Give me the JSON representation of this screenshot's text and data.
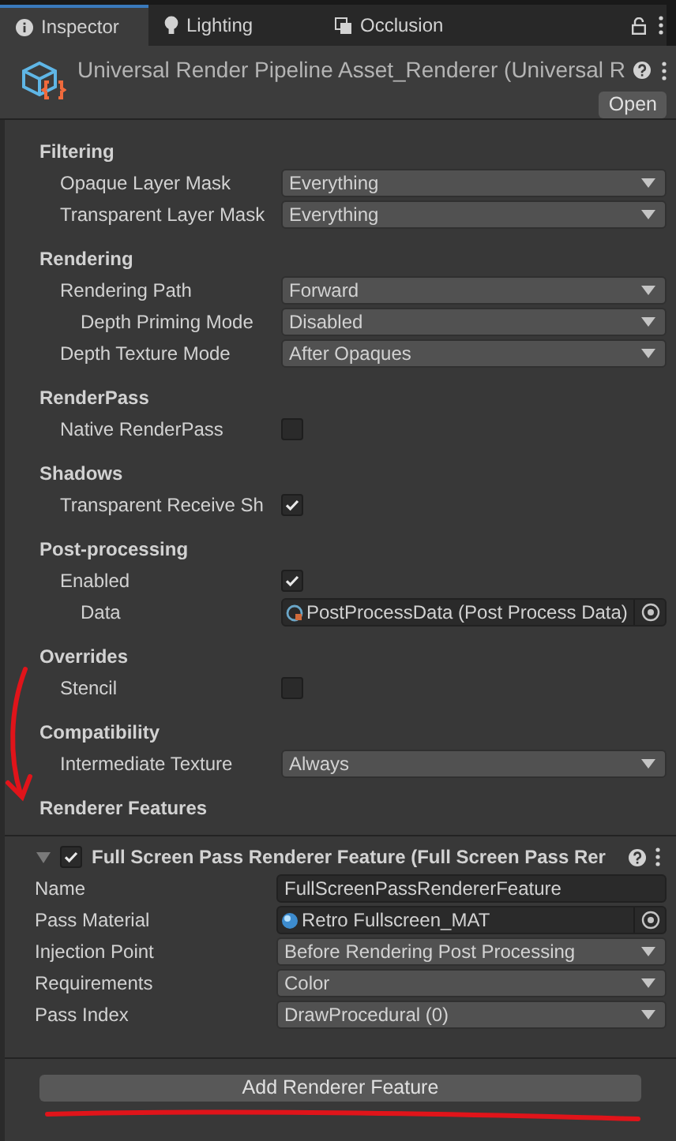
{
  "tabs": [
    {
      "label": "Inspector",
      "selected": true
    },
    {
      "label": "Lighting",
      "selected": false
    },
    {
      "label": "Occlusion",
      "selected": false
    }
  ],
  "header": {
    "title": "Universal Render Pipeline Asset_Renderer (Universal R",
    "open_button": "Open"
  },
  "sections": [
    {
      "title": "Filtering",
      "fields": [
        {
          "label": "Opaque Layer Mask",
          "kind": "dropdown",
          "value": "Everything"
        },
        {
          "label": "Transparent Layer Mask",
          "kind": "dropdown",
          "value": "Everything"
        }
      ]
    },
    {
      "title": "Rendering",
      "fields": [
        {
          "label": "Rendering Path",
          "kind": "dropdown",
          "value": "Forward",
          "children": [
            {
              "label": "Depth Priming Mode",
              "kind": "dropdown",
              "value": "Disabled"
            }
          ]
        },
        {
          "label": "Depth Texture Mode",
          "kind": "dropdown",
          "value": "After Opaques"
        }
      ]
    },
    {
      "title": "RenderPass",
      "fields": [
        {
          "label": "Native RenderPass",
          "kind": "checkbox",
          "checked": false
        }
      ]
    },
    {
      "title": "Shadows",
      "fields": [
        {
          "label": "Transparent Receive Sh",
          "kind": "checkbox",
          "checked": true
        }
      ]
    },
    {
      "title": "Post-processing",
      "fields": [
        {
          "label": "Enabled",
          "kind": "checkbox",
          "checked": true,
          "children": [
            {
              "label": "Data",
              "kind": "object",
              "value": "PostProcessData (Post Process Data)"
            }
          ]
        }
      ]
    },
    {
      "title": "Overrides",
      "fields": [
        {
          "label": "Stencil",
          "kind": "checkbox",
          "checked": false
        }
      ]
    },
    {
      "title": "Compatibility",
      "fields": [
        {
          "label": "Intermediate Texture",
          "kind": "dropdown",
          "value": "Always"
        }
      ]
    },
    {
      "title": "Renderer Features"
    }
  ],
  "feature": {
    "title": "Full Screen Pass Renderer Feature (Full Screen Pass Rer",
    "expanded": true,
    "enabled": true,
    "fields": [
      {
        "label": "Name",
        "kind": "text",
        "value": "FullScreenPassRendererFeature"
      },
      {
        "label": "Pass Material",
        "kind": "material",
        "value": "Retro Fullscreen_MAT"
      },
      {
        "label": "Injection Point",
        "kind": "dropdown",
        "value": "Before Rendering Post Processing"
      },
      {
        "label": "Requirements",
        "kind": "dropdown",
        "value": "Color"
      },
      {
        "label": "Pass Index",
        "kind": "dropdown",
        "value": "DrawProcedural (0)"
      }
    ]
  },
  "add_button": "Add Renderer Feature"
}
